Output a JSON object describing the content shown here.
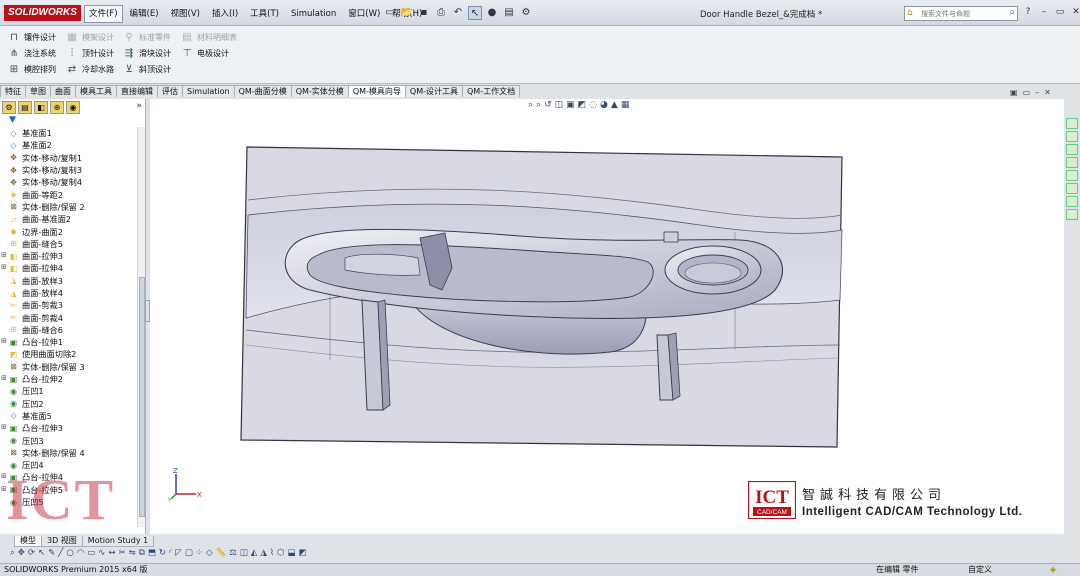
{
  "app": {
    "logo_text": "SOLIDWORKS",
    "document_title": "Door Handle Bezel_&完成档 *"
  },
  "menu": [
    "文件(F)",
    "编辑(E)",
    "视图(V)",
    "插入(I)",
    "工具(T)",
    "Simulation",
    "窗口(W)",
    "帮助(H)"
  ],
  "search": {
    "placeholder": "搜索文件与命题"
  },
  "ribbon": {
    "row1": [
      {
        "label": "镶件设计",
        "icon": "insert-design-icon",
        "dim": false
      },
      {
        "label": "模架设计",
        "icon": "mold-base-icon",
        "dim": true
      },
      {
        "label": "标准零件",
        "icon": "standard-part-icon",
        "dim": true
      },
      {
        "label": "材料明细表",
        "icon": "bom-icon",
        "dim": true
      }
    ],
    "row2": [
      {
        "label": "浇注系统",
        "icon": "runner-system-icon"
      },
      {
        "label": "顶针设计",
        "icon": "ejector-pin-icon"
      },
      {
        "label": "滑块设计",
        "icon": "slider-icon"
      },
      {
        "label": "电极设计",
        "icon": "electrode-icon"
      }
    ],
    "row3": [
      {
        "label": "模腔排列",
        "icon": "cavity-layout-icon"
      },
      {
        "label": "冷却水路",
        "icon": "cooling-channel-icon"
      },
      {
        "label": "斜顶设计",
        "icon": "lifter-icon"
      }
    ]
  },
  "tabs": [
    {
      "label": "特征"
    },
    {
      "label": "草图"
    },
    {
      "label": "曲面"
    },
    {
      "label": "模具工具"
    },
    {
      "label": "直接编辑"
    },
    {
      "label": "评估"
    },
    {
      "label": "Simulation"
    },
    {
      "label": "QM-曲面分模"
    },
    {
      "label": "QM-实体分模"
    },
    {
      "label": "QM-模具向导",
      "active": true
    },
    {
      "label": "QM-设计工具"
    },
    {
      "label": "QM-工作文档"
    }
  ],
  "tree": [
    {
      "label": "基准面1",
      "icon": "plane-icon",
      "expand": false
    },
    {
      "label": "基准面2",
      "icon": "plane-icon",
      "expand": false
    },
    {
      "label": "实体-移动/复制1",
      "icon": "move-copy-icon",
      "expand": false
    },
    {
      "label": "实体-移动/复制3",
      "icon": "move-copy-icon",
      "expand": false
    },
    {
      "label": "实体-移动/复制4",
      "icon": "move-copy-icon",
      "expand": false
    },
    {
      "label": "曲面-等距2",
      "icon": "surface-offset-icon",
      "expand": false
    },
    {
      "label": "实体-删除/保留 2",
      "icon": "delete-body-icon",
      "expand": false
    },
    {
      "label": "曲面-基准面2",
      "icon": "planar-surface-icon",
      "expand": false
    },
    {
      "label": "边界-曲面2",
      "icon": "boundary-surface-icon",
      "expand": false
    },
    {
      "label": "曲面-缝合5",
      "icon": "knit-surface-icon",
      "expand": false
    },
    {
      "label": "曲面-拉伸3",
      "icon": "extrude-surface-icon",
      "expand": true
    },
    {
      "label": "曲面-拉伸4",
      "icon": "extrude-surface-icon",
      "expand": true
    },
    {
      "label": "曲面-放样3",
      "icon": "loft-surface-icon",
      "expand": false
    },
    {
      "label": "曲面-放样4",
      "icon": "loft-surface-icon",
      "expand": false
    },
    {
      "label": "曲面-剪裁3",
      "icon": "trim-surface-icon",
      "expand": false
    },
    {
      "label": "曲面-剪裁4",
      "icon": "trim-surface-icon",
      "expand": false
    },
    {
      "label": "曲面-缝合6",
      "icon": "knit-surface-icon",
      "expand": false
    },
    {
      "label": "凸台-拉伸1",
      "icon": "boss-extrude-icon",
      "expand": true
    },
    {
      "label": "使用曲面切除2",
      "icon": "surface-cut-icon",
      "expand": false
    },
    {
      "label": "实体-删除/保留 3",
      "icon": "delete-body-icon",
      "expand": false
    },
    {
      "label": "凸台-拉伸2",
      "icon": "boss-extrude-icon",
      "expand": true
    },
    {
      "label": "压凹1",
      "icon": "indent-icon",
      "expand": false
    },
    {
      "label": "压凹2",
      "icon": "indent-icon",
      "expand": false
    },
    {
      "label": "基准面5",
      "icon": "plane-icon",
      "expand": false
    },
    {
      "label": "凸台-拉伸3",
      "icon": "boss-extrude-icon",
      "expand": true
    },
    {
      "label": "压凹3",
      "icon": "indent-icon",
      "expand": false
    },
    {
      "label": "实体-删除/保留 4",
      "icon": "delete-body-icon",
      "expand": false
    },
    {
      "label": "压凹4",
      "icon": "indent-icon",
      "expand": false
    },
    {
      "label": "凸台-拉伸4",
      "icon": "boss-extrude-icon",
      "expand": true
    },
    {
      "label": "凸台-拉伸5",
      "icon": "boss-extrude-icon",
      "expand": true
    },
    {
      "label": "压凹5",
      "icon": "indent-icon",
      "expand": false
    }
  ],
  "bottom_tabs": [
    {
      "label": "模型",
      "active": true
    },
    {
      "label": "3D 视图"
    },
    {
      "label": "Motion Study 1"
    }
  ],
  "status": {
    "left": "SOLIDWORKS Premium 2015 x64 版",
    "editing": "在编辑 零件",
    "units": "自定义"
  },
  "watermark": {
    "large_mark": "ICT",
    "logo_mark": "ICT",
    "logo_subtext": "CAD/CAM",
    "company_cn": "智誠科技有限公司",
    "company_en": "Intelligent CAD/CAM Technology Ltd."
  },
  "axes": {
    "x": "X",
    "y": "Y",
    "z": "Z"
  },
  "colors": {
    "brand_red": "#b8111a",
    "tree_icon_yellow": "#e7b827",
    "tree_icon_green": "#3b8a2e",
    "model_fill": "#d6d6e2",
    "model_edge": "#3c3c4e"
  }
}
